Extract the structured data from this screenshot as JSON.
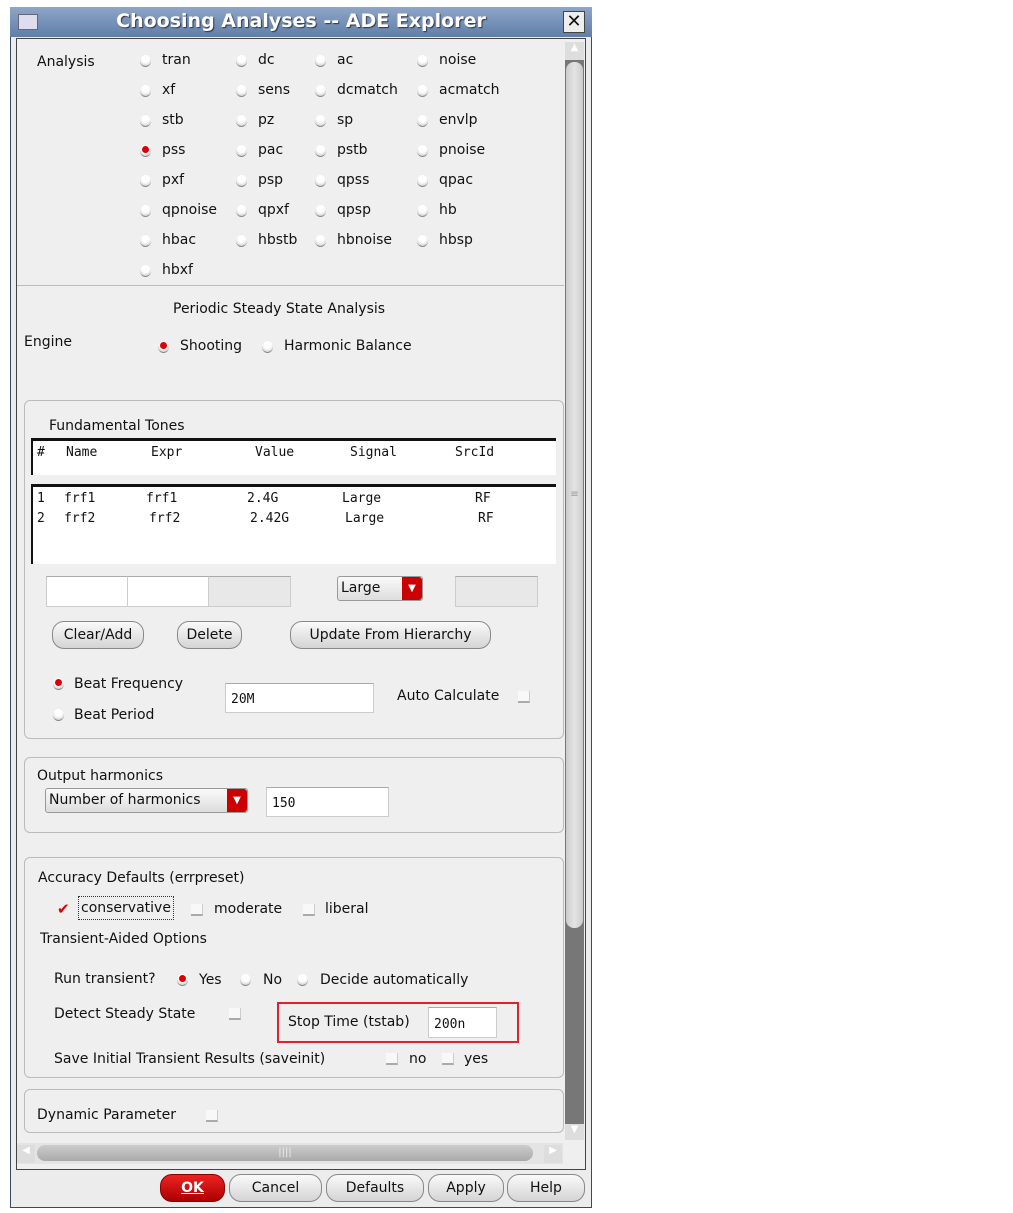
{
  "window": {
    "title": "Choosing Analyses -- ADE Explorer"
  },
  "analysis": {
    "label": "Analysis",
    "selected": "pss",
    "options": [
      "tran",
      "dc",
      "ac",
      "noise",
      "xf",
      "sens",
      "dcmatch",
      "acmatch",
      "stb",
      "pz",
      "sp",
      "envlp",
      "pss",
      "pac",
      "pstb",
      "pnoise",
      "pxf",
      "psp",
      "qpss",
      "qpac",
      "qpnoise",
      "qpxf",
      "qpsp",
      "hb",
      "hbac",
      "hbstb",
      "hbnoise",
      "hbsp",
      "hbxf"
    ]
  },
  "pss": {
    "heading": "Periodic Steady State Analysis",
    "engine_label": "Engine",
    "engine_shooting": "Shooting",
    "engine_hb": "Harmonic Balance",
    "engine_selected": "Shooting"
  },
  "tones": {
    "title": "Fundamental Tones",
    "headers": [
      "#",
      "Name",
      "Expr",
      "Value",
      "Signal",
      "SrcId"
    ],
    "rows": [
      [
        "1",
        "frf1",
        "frf1",
        "2.4G",
        "Large",
        "RF"
      ],
      [
        "2",
        "frf2",
        "frf2",
        "2.42G",
        "Large",
        "RF"
      ]
    ],
    "signal_select": "Large",
    "clear_add": "Clear/Add",
    "delete": "Delete",
    "update": "Update From Hierarchy",
    "beat_frequency": "Beat Frequency",
    "beat_period": "Beat Period",
    "beat_value": "20M",
    "auto_calculate": "Auto Calculate"
  },
  "harmonics": {
    "title": "Output harmonics",
    "select": "Number of harmonics",
    "value": "150"
  },
  "accuracy": {
    "title": "Accuracy Defaults (errpreset)",
    "conservative": "conservative",
    "moderate": "moderate",
    "liberal": "liberal",
    "transient_title": "Transient-Aided Options",
    "run_transient": "Run transient?",
    "yes": "Yes",
    "no": "No",
    "decide": "Decide automatically",
    "detect_steady": "Detect Steady State",
    "stop_time_label": "Stop Time (tstab)",
    "stop_time": "200n",
    "save_init": "Save Initial Transient Results (saveinit)",
    "save_no": "no",
    "save_yes": "yes"
  },
  "dynamic": {
    "label": "Dynamic Parameter"
  },
  "buttons": {
    "ok": "OK",
    "cancel": "Cancel",
    "defaults": "Defaults",
    "apply": "Apply",
    "help": "Help"
  },
  "colors": {
    "accent": "#cc0000",
    "highlight_box": "#e0202a"
  }
}
